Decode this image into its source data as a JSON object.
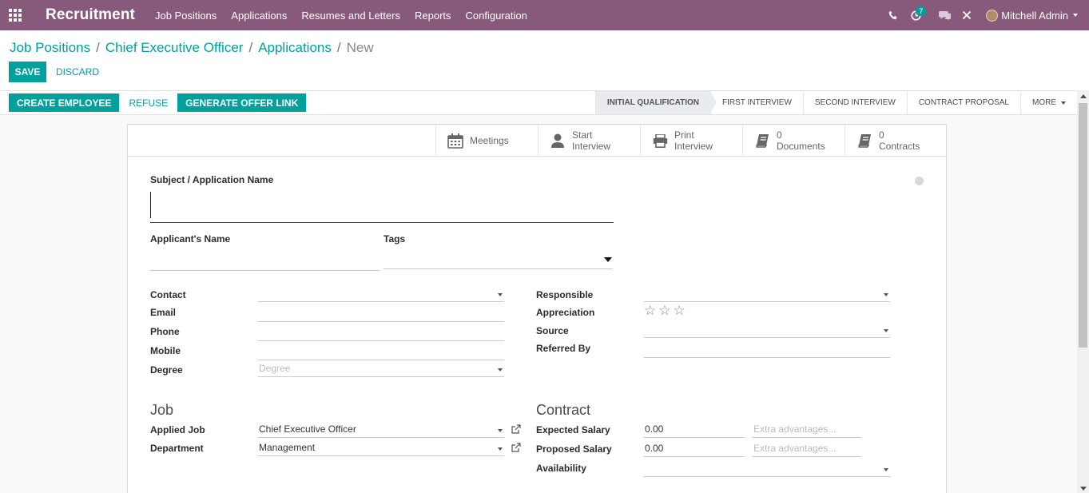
{
  "navbar": {
    "app_name": "Recruitment",
    "menu": [
      "Job Positions",
      "Applications",
      "Resumes and Letters",
      "Reports",
      "Configuration"
    ],
    "activity_count": "7",
    "user_name": "Mitchell Admin",
    "bg_color": "#875a7b"
  },
  "breadcrumb": {
    "items": [
      "Job Positions",
      "Chief Executive Officer",
      "Applications"
    ],
    "current": "New"
  },
  "actions": {
    "save": "SAVE",
    "discard": "DISCARD"
  },
  "statusbar": {
    "buttons": [
      "CREATE EMPLOYEE",
      "REFUSE",
      "GENERATE OFFER LINK"
    ],
    "stages": [
      "INITIAL QUALIFICATION",
      "FIRST INTERVIEW",
      "SECOND INTERVIEW",
      "CONTRACT PROPOSAL"
    ],
    "current_stage": "INITIAL QUALIFICATION",
    "more": "MORE"
  },
  "smart_buttons": [
    {
      "icon": "calendar-icon",
      "line1": "Meetings",
      "line2": ""
    },
    {
      "icon": "user-icon",
      "line1": "Start",
      "line2": "Interview"
    },
    {
      "icon": "print-icon",
      "line1": "Print",
      "line2": "Interview"
    },
    {
      "icon": "book-icon",
      "line1": "0",
      "line2": "Documents"
    },
    {
      "icon": "book-icon",
      "line1": "0",
      "line2": "Contracts"
    }
  ],
  "form": {
    "subject_label": "Subject / Application Name",
    "subject_value": "",
    "applicant_name_label": "Applicant's Name",
    "tags_label": "Tags",
    "contact_label": "Contact",
    "email_label": "Email",
    "phone_label": "Phone",
    "mobile_label": "Mobile",
    "degree_label": "Degree",
    "degree_placeholder": "Degree",
    "responsible_label": "Responsible",
    "appreciation_label": "Appreciation",
    "appreciation_stars": 0,
    "appreciation_max": 3,
    "source_label": "Source",
    "referred_by_label": "Referred By",
    "job_section": "Job",
    "applied_job_label": "Applied Job",
    "applied_job_value": "Chief Executive Officer",
    "department_label": "Department",
    "department_value": "Management",
    "contract_section": "Contract",
    "expected_salary_label": "Expected Salary",
    "expected_salary_value": "0.00",
    "expected_extra_placeholder": "Extra advantages...",
    "proposed_salary_label": "Proposed Salary",
    "proposed_salary_value": "0.00",
    "proposed_extra_placeholder": "Extra advantages...",
    "availability_label": "Availability"
  }
}
